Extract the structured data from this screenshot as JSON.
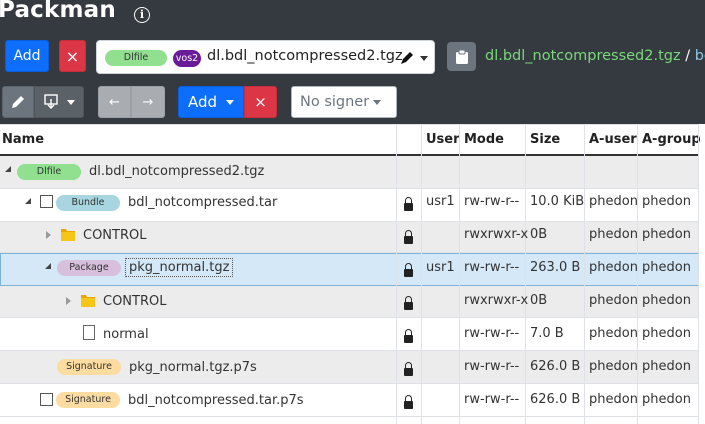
{
  "app": {
    "title": "Packman",
    "info_icon": "i"
  },
  "topbar": {
    "add_label": "Add",
    "remove_label": "×",
    "selector": {
      "type_badge": "Dlfile",
      "vos_badge": "vos2",
      "value": "dl.bdl_notcompressed2.tgz"
    },
    "path": {
      "segment1": "dl.bdl_notcompressed2.tgz",
      "separator": "/",
      "segment2": "bdl"
    }
  },
  "toolbar": {
    "add_label": "Add",
    "remove_label": "×",
    "prev_label": "←",
    "next_label": "→",
    "signer_label": "No signer"
  },
  "table": {
    "columns": [
      "Name",
      "User",
      "Mode",
      "Size",
      "A-user",
      "A-group"
    ],
    "rows": [
      {
        "badge": "Dlfile",
        "name": "dl.bdl_notcompressed2.tgz",
        "user": "",
        "mode": "",
        "size": "",
        "auser": "",
        "agroup": ""
      },
      {
        "badge": "Bundle",
        "name": "bdl_notcompressed.tar",
        "user": "usr1",
        "mode": "rw-rw-r--",
        "size": "10.0 KiB",
        "auser": "phedon",
        "agroup": "phedon"
      },
      {
        "badge": "",
        "name": "CONTROL",
        "user": "",
        "mode": "rwxrwxr-x",
        "size": "0B",
        "auser": "phedon",
        "agroup": "phedon"
      },
      {
        "badge": "Package",
        "name": "pkg_normal.tgz",
        "user": "usr1",
        "mode": "rw-rw-r--",
        "size": "263.0 B",
        "auser": "phedon",
        "agroup": "phedon"
      },
      {
        "badge": "",
        "name": "CONTROL",
        "user": "",
        "mode": "rwxrwxr-x",
        "size": "0B",
        "auser": "phedon",
        "agroup": "phedon"
      },
      {
        "badge": "",
        "name": "normal",
        "user": "",
        "mode": "rw-rw-r--",
        "size": "7.0 B",
        "auser": "phedon",
        "agroup": "phedon"
      },
      {
        "badge": "Signature",
        "name": "pkg_normal.tgz.p7s",
        "user": "",
        "mode": "rw-rw-r--",
        "size": "626.0 B",
        "auser": "phedon",
        "agroup": "phedon"
      },
      {
        "badge": "Signature",
        "name": "bdl_notcompressed.tar.p7s",
        "user": "",
        "mode": "rw-rw-r--",
        "size": "626.0 B",
        "auser": "phedon",
        "agroup": "phedon"
      }
    ]
  },
  "colors": {
    "header_bg": "#343a40",
    "primary": "#0d6efd",
    "danger": "#dc3545",
    "secondary": "#6c757d",
    "selected_row": "#d4e8f7"
  }
}
